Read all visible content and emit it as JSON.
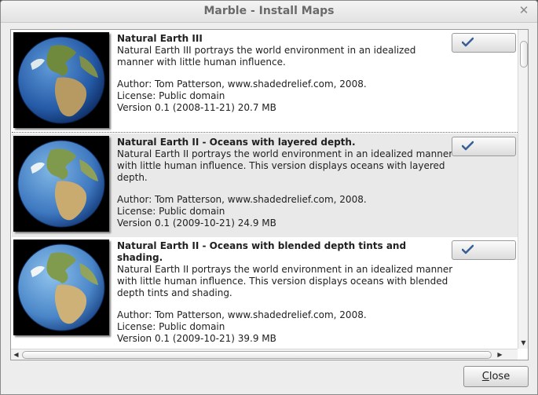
{
  "window": {
    "title": "Marble - Install Maps"
  },
  "icons": {
    "close": "close-x-icon",
    "install_state": "checkmark-icon"
  },
  "colors": {
    "ocean": "#2f66b0",
    "land": "#6f8a3c",
    "check": "#3a5f94",
    "selected_row": "#e9e9e9"
  },
  "maps": [
    {
      "name": "Natural Earth III",
      "description": "Natural Earth III portrays the world environment in an idealized manner with little human influence.",
      "author": "Author: Tom Patterson, www.shadedrelief.com, 2008.",
      "license": "License: Public domain",
      "version": "Version 0.1 (2008-11-21) 20.7 MB"
    },
    {
      "name": "Natural Earth II - Oceans with layered depth.",
      "description": "Natural Earth II portrays the world environment in an idealized manner with little human influence. This version displays oceans with layered depth.",
      "author": "Author: Tom Patterson, www.shadedrelief.com, 2008.",
      "license": "License: Public domain",
      "version": "Version 0.1 (2009-10-21) 24.9 MB"
    },
    {
      "name": "Natural Earth II - Oceans with blended depth tints and shading.",
      "description": "Natural Earth II portrays the world environment in an idealized manner with little human influence. This version displays oceans with blended depth tints and shading.",
      "author": "Author: Tom Patterson, www.shadedrelief.com, 2008.",
      "license": "License: Public domain",
      "version": "Version 0.1 (2009-10-21) 39.9 MB"
    }
  ],
  "footer": {
    "close_label_first": "C",
    "close_label_rest": "lose"
  }
}
